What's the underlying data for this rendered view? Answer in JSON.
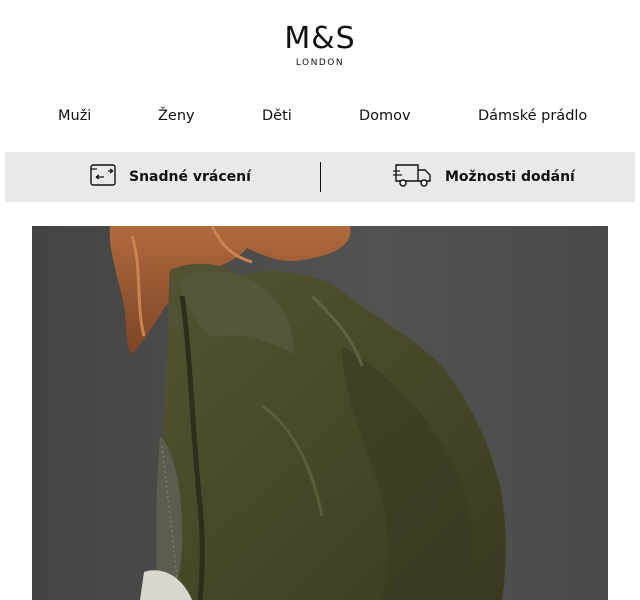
{
  "brand": {
    "name": "M&S",
    "sub": "LONDON"
  },
  "nav": {
    "items": [
      "Muži",
      "Ženy",
      "Děti",
      "Domov",
      "Dámské prádlo"
    ]
  },
  "info_bar": {
    "returns_label": "Snadné vrácení",
    "returns_icon": "return-box-icon",
    "delivery_label": "Možnosti dodání",
    "delivery_icon": "delivery-truck-icon"
  },
  "hero": {
    "colors": {
      "background": "#4c4c4b",
      "jacket": "#4a4a2c",
      "hair": "#9a5a32"
    }
  }
}
